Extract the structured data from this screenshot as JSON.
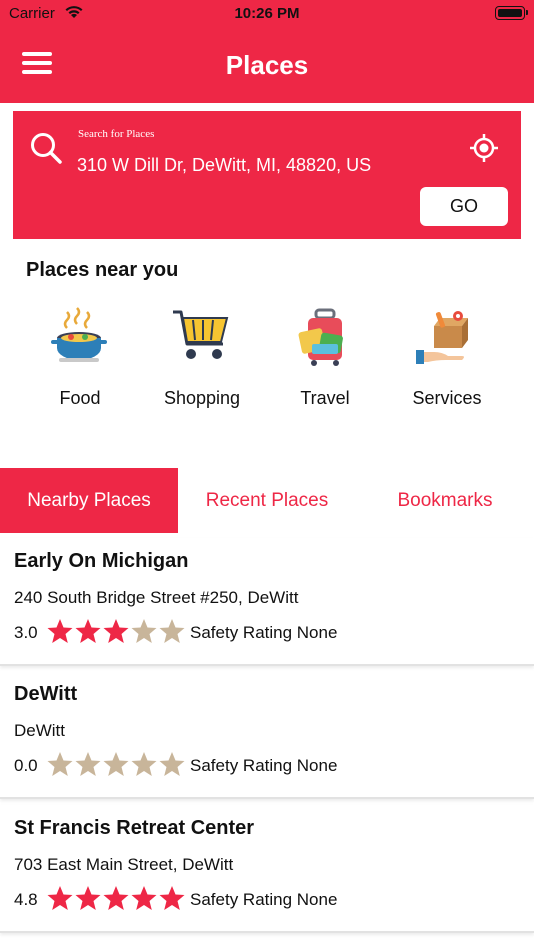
{
  "status_bar": {
    "carrier": "Carrier",
    "time": "10:26 PM"
  },
  "nav": {
    "title": "Places"
  },
  "search": {
    "label": "Search for Places",
    "value": "310 W Dill Dr, DeWitt, MI, 48820, US",
    "go_label": "GO"
  },
  "near_you": {
    "title": "Places near you",
    "categories": [
      {
        "label": "Food",
        "icon": "food-pot-icon"
      },
      {
        "label": "Shopping",
        "icon": "shopping-cart-icon"
      },
      {
        "label": "Travel",
        "icon": "luggage-icon"
      },
      {
        "label": "Services",
        "icon": "services-box-icon"
      }
    ]
  },
  "tabs": [
    {
      "label": "Nearby Places",
      "active": true
    },
    {
      "label": "Recent Places",
      "active": false
    },
    {
      "label": "Bookmarks",
      "active": false
    }
  ],
  "places": [
    {
      "name": "Early On Michigan",
      "address": "240 South Bridge Street #250, DeWitt",
      "rating": "3.0",
      "stars": 3,
      "safety": "Safety Rating None"
    },
    {
      "name": "DeWitt",
      "address": "DeWitt",
      "rating": "0.0",
      "stars": 0,
      "safety": "Safety Rating None"
    },
    {
      "name": "St Francis Retreat Center",
      "address": "703 East Main Street, DeWitt",
      "rating": "4.8",
      "stars": 5,
      "safety": "Safety Rating None"
    }
  ],
  "colors": {
    "brand": "#ee2746",
    "star_filled": "#ee2746",
    "star_empty": "#c8b59a"
  }
}
